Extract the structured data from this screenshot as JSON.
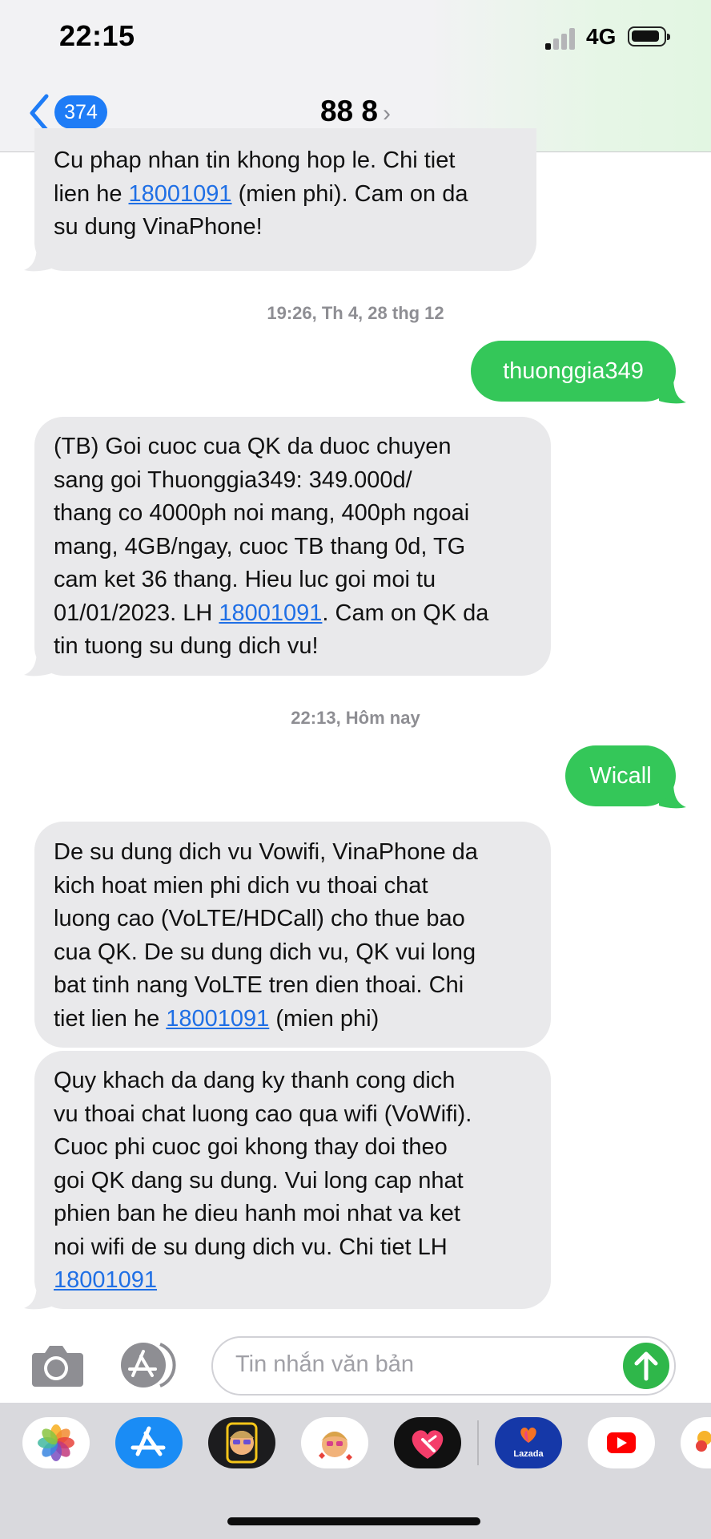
{
  "status_bar": {
    "time": "22:15",
    "network": "4G"
  },
  "nav": {
    "back_count": "374",
    "contact_name": "88 8",
    "contact_chevron": "›"
  },
  "messages": [
    {
      "lines": [
        "Cu phap nhan tin khong hop le. Chi tiet",
        "lien he ",
        "18001091",
        " (mien phi). Cam on da",
        "su dung VinaPhone!"
      ]
    },
    {
      "timestamp": "19:26, Th 4, 28 thg 12"
    },
    {
      "text": "thuonggia349"
    },
    {
      "lines": [
        "(TB) Goi cuoc cua QK da duoc chuyen",
        "sang goi Thuonggia349: 349.000d/",
        "thang co 4000ph noi mang, 400ph ngoai",
        "mang, 4GB/ngay, cuoc TB thang 0d, TG",
        "cam ket 36 thang. Hieu luc goi moi tu",
        "01/01/2023. LH ",
        "18001091",
        ". Cam on QK da",
        "tin tuong su dung dich vu!"
      ]
    },
    {
      "timestamp": "22:13, Hôm nay"
    },
    {
      "text": "Wicall"
    },
    {
      "lines": [
        "De su dung dich vu Vowifi, VinaPhone da",
        "kich hoat mien phi dich vu thoai chat",
        "luong cao (VoLTE/HDCall) cho thue bao",
        "cua QK. De su dung dich vu, QK vui long",
        "bat tinh nang VoLTE tren dien thoai. Chi",
        "tiet lien he ",
        "18001091",
        " (mien phi)"
      ]
    },
    {
      "lines": [
        "Quy khach da dang ky thanh cong dich",
        "vu thoai chat luong cao qua wifi (VoWifi).",
        "Cuoc phi cuoc goi khong thay doi theo",
        "goi QK dang su dung. Vui long cap nhat",
        "phien ban he dieu hanh moi nhat va ket",
        "noi wifi de su dung dich vu. Chi tiet LH",
        "18001091"
      ]
    }
  ],
  "composer": {
    "placeholder": "Tin nhắn văn bản"
  },
  "tray": {
    "lazada_label": "Lazada"
  },
  "colors": {
    "incoming": "#e9e9eb",
    "outgoing": "#34c759",
    "link": "#1f6fe5",
    "badge": "#1e7cf6",
    "send": "#2fb74a"
  },
  "icons": [
    "chevron-left-icon",
    "camera-icon",
    "app-store-icon",
    "send-arrow-icon",
    "photos-icon",
    "memoji-icon",
    "heart-app-icon",
    "lazada-icon",
    "youtube-icon"
  ]
}
